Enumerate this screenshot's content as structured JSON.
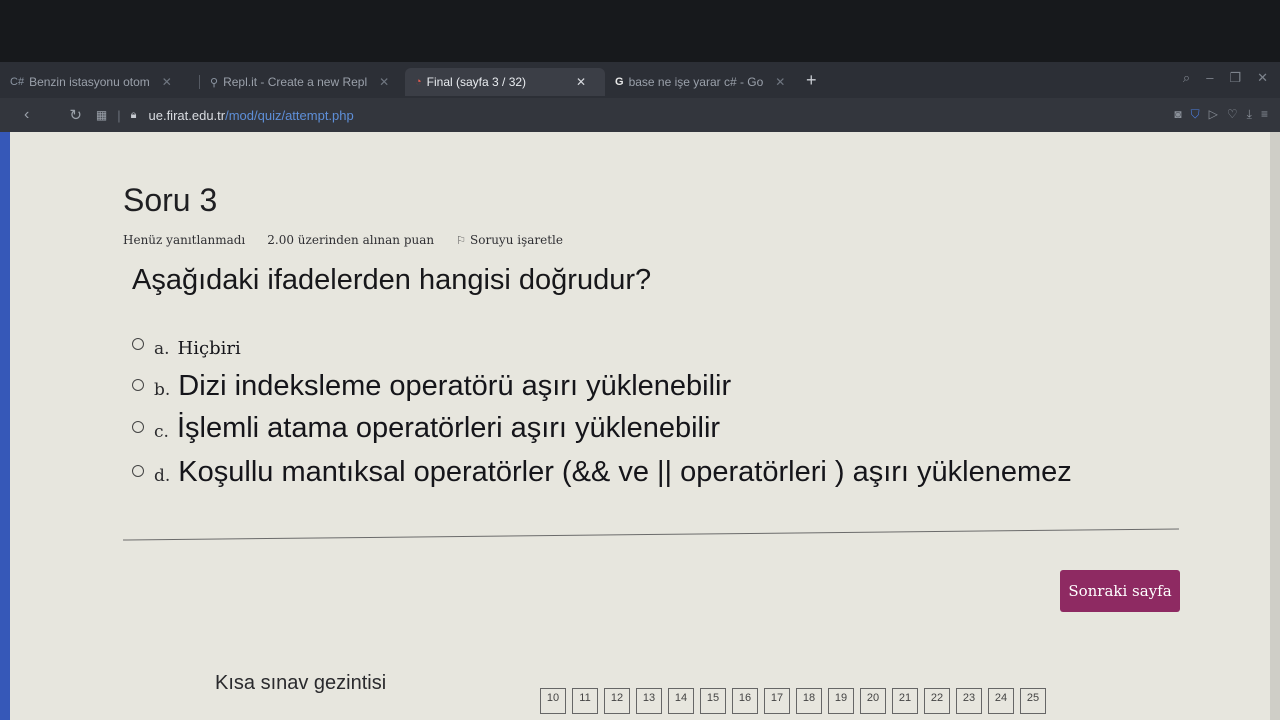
{
  "browser": {
    "tabs": [
      {
        "icon": "C#",
        "label": "Benzin istasyonu otom",
        "active": false
      },
      {
        "icon": "⚲",
        "label": "Repl.it - Create a new Repl",
        "active": false
      },
      {
        "icon": "◔",
        "label": "Final (sayfa 3 / 32)",
        "active": true
      },
      {
        "icon": "G",
        "label": "base ne işe yarar c# - Go",
        "active": false
      }
    ],
    "new_tab": "+",
    "url_host": "ue.firat.edu.tr",
    "url_path": "/mod/quiz/attempt.php"
  },
  "question": {
    "number_label": "Soru 3",
    "status": "Henüz yanıtlanmadı",
    "points": "2.00 üzerinden alınan puan",
    "flag_label": "Soruyu işaretle",
    "text": "Aşağıdaki ifadelerden hangisi doğrudur?"
  },
  "answers": [
    {
      "letter": "a.",
      "text": "Hiçbiri"
    },
    {
      "letter": "b.",
      "text": "Dizi indeksleme operatörü aşırı yüklenebilir"
    },
    {
      "letter": "c.",
      "text": "İşlemli atama operatörleri aşırı yüklenebilir"
    },
    {
      "letter": "d.",
      "text": "Koşullu mantıksal operatörler (&& ve || operatörleri ) aşırı yüklenemez"
    }
  ],
  "next_button": "Sonraki sayfa",
  "quiz_nav": {
    "title": "Kısa sınav gezintisi",
    "items": [
      "10",
      "11",
      "12",
      "13",
      "14",
      "15",
      "16",
      "17",
      "18",
      "19",
      "20",
      "21",
      "22",
      "23",
      "24",
      "25"
    ]
  },
  "colors": {
    "accent_button": "#8e2a62",
    "page_background": "#e7e6de"
  }
}
